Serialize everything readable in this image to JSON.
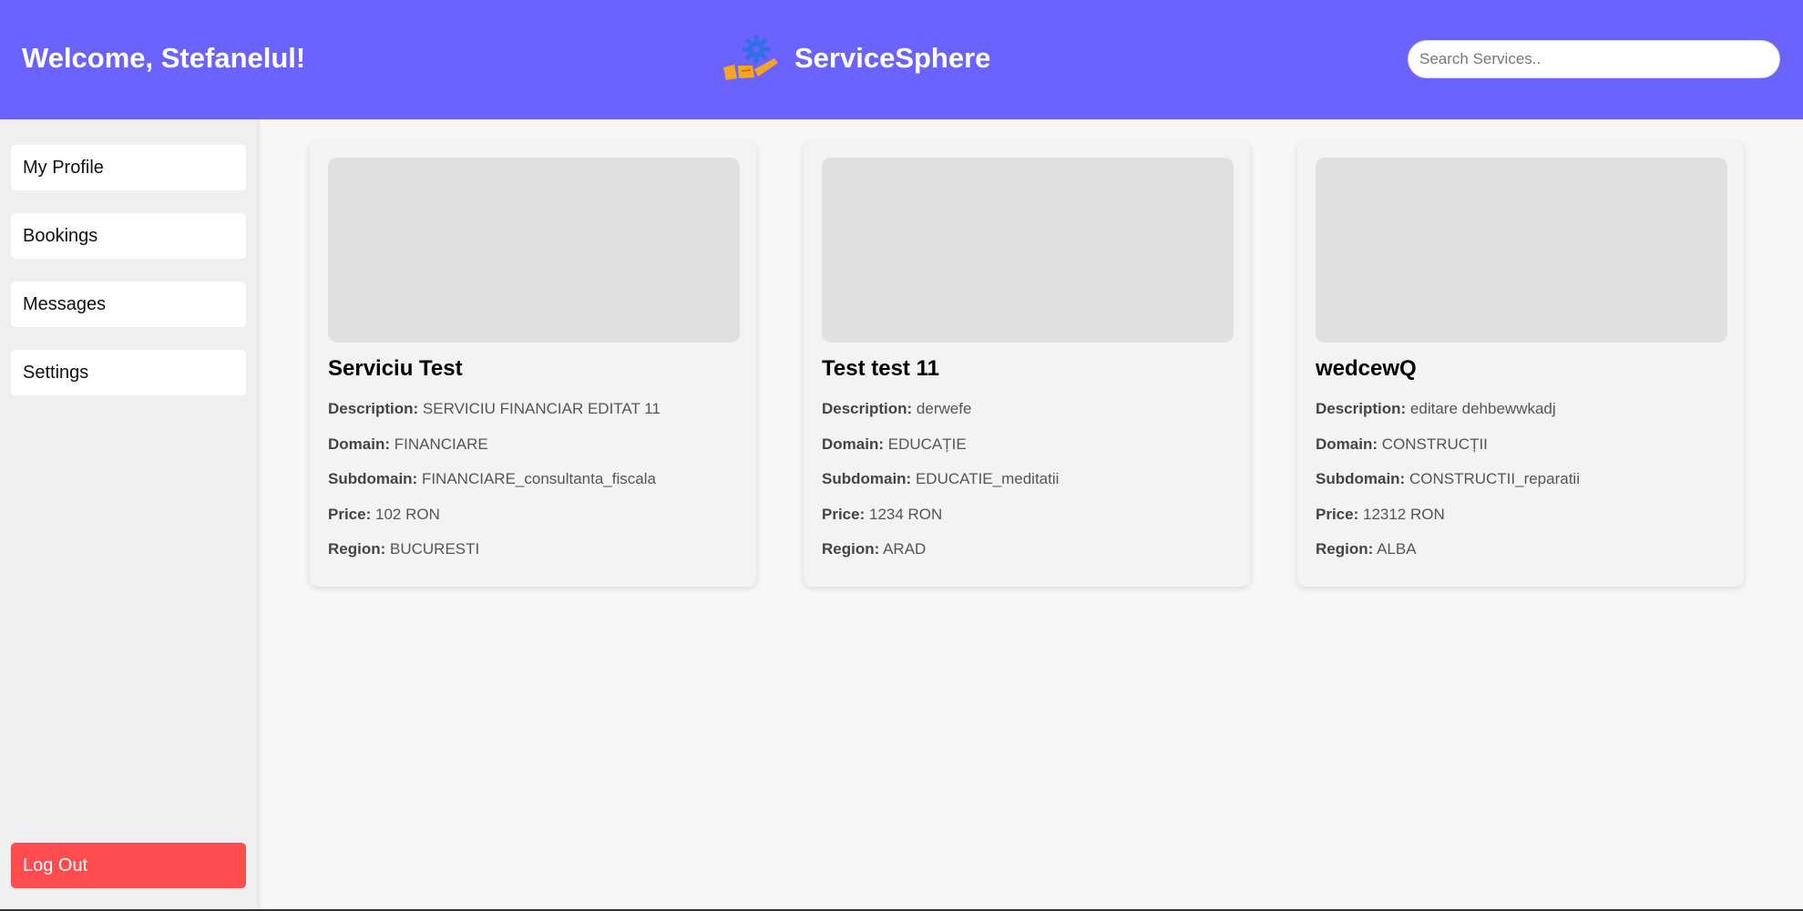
{
  "header": {
    "welcome": "Welcome, Stefanelul!",
    "brand_name": "ServiceSphere",
    "logo_icon": "hand-gear-logo-icon",
    "search_placeholder": "Search Services..",
    "background_color": "#6b63ff"
  },
  "sidebar": {
    "items": [
      {
        "label": "My Profile"
      },
      {
        "label": "Bookings"
      },
      {
        "label": "Messages"
      },
      {
        "label": "Settings"
      }
    ],
    "logout_label": "Log Out",
    "logout_color": "#ff4d4f"
  },
  "field_labels": {
    "description": "Description:",
    "domain": "Domain:",
    "subdomain": "Subdomain:",
    "price": "Price:",
    "region": "Region:"
  },
  "services": [
    {
      "title": "Serviciu Test",
      "description": "SERVICIU FINANCIAR EDITAT 11",
      "domain": "FINANCIARE",
      "subdomain": "FINANCIARE_consultanta_fiscala",
      "price": "102 RON",
      "region": "BUCURESTI"
    },
    {
      "title": "Test test 11",
      "description": "derwefe",
      "domain": "EDUCAȚIE",
      "subdomain": "EDUCATIE_meditatii",
      "price": "1234 RON",
      "region": "ARAD"
    },
    {
      "title": "wedcewQ",
      "description": "editare dehbewwkadj",
      "domain": "CONSTRUCȚII",
      "subdomain": "CONSTRUCTII_reparatii",
      "price": "12312 RON",
      "region": "ALBA"
    }
  ]
}
